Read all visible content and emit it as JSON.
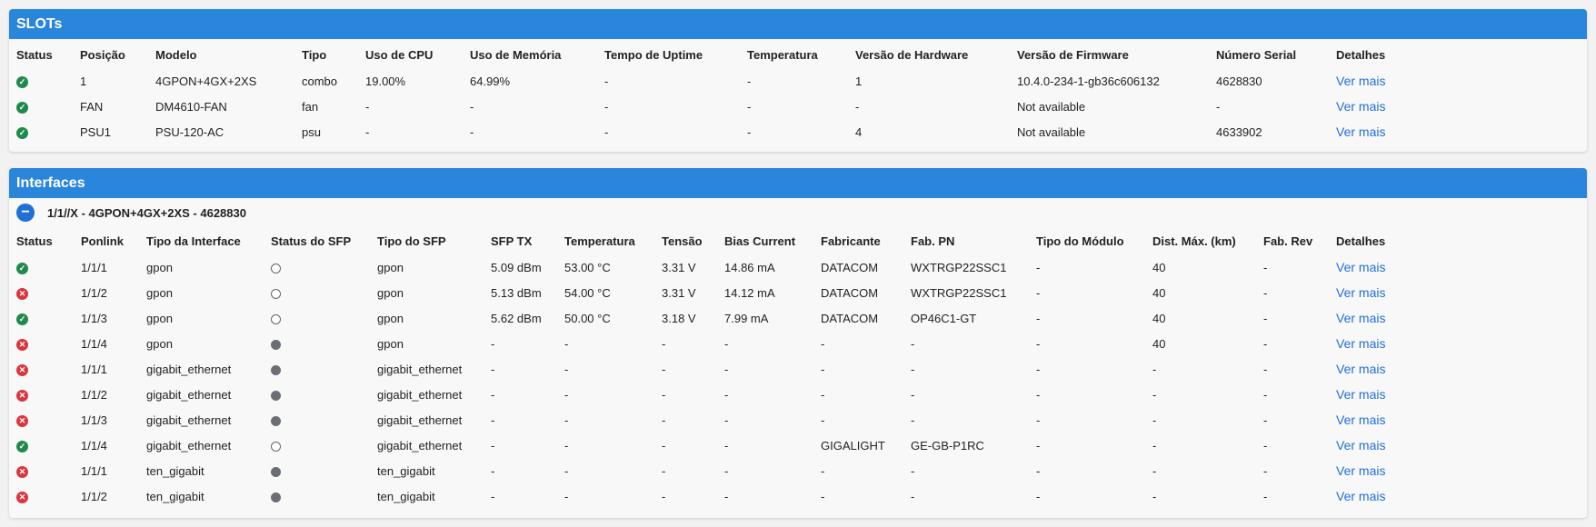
{
  "slots": {
    "title": "SLOTs",
    "columns": [
      "Status",
      "Posição",
      "Modelo",
      "Tipo",
      "Uso de CPU",
      "Uso de Memória",
      "Tempo de Uptime",
      "Temperatura",
      "Versão de Hardware",
      "Versão de Firmware",
      "Número Serial",
      "Detalhes"
    ],
    "rows": [
      {
        "status": "ok",
        "position": "1",
        "model": "4GPON+4GX+2XS",
        "type": "combo",
        "cpu": "19.00%",
        "memory": "64.99%",
        "uptime": "-",
        "temperature": "-",
        "hw": "1",
        "fw": "10.4.0-234-1-gb36c606132",
        "serial": "4628830",
        "details": "Ver mais"
      },
      {
        "status": "ok",
        "position": "FAN",
        "model": "DM4610-FAN",
        "type": "fan",
        "cpu": "-",
        "memory": "-",
        "uptime": "-",
        "temperature": "-",
        "hw": "-",
        "fw": "Not available",
        "serial": "-",
        "details": "Ver mais"
      },
      {
        "status": "ok",
        "position": "PSU1",
        "model": "PSU-120-AC",
        "type": "psu",
        "cpu": "-",
        "memory": "-",
        "uptime": "-",
        "temperature": "-",
        "hw": "4",
        "fw": "Not available",
        "serial": "4633902",
        "details": "Ver mais"
      }
    ]
  },
  "interfaces": {
    "title": "Interfaces",
    "group_title": "1/1//X - 4GPON+4GX+2XS - 4628830",
    "toggle_symbol": "−",
    "columns": [
      "Status",
      "Ponlink",
      "Tipo da Interface",
      "Status do SFP",
      "Tipo do SFP",
      "SFP TX",
      "Temperatura",
      "Tensão",
      "Bias Current",
      "Fabricante",
      "Fab. PN",
      "Tipo do Módulo",
      "Dist. Máx. (km)",
      "Fab. Rev",
      "Detalhes"
    ],
    "rows": [
      {
        "status": "ok",
        "ponlink": "1/1/1",
        "iface_type": "gpon",
        "sfp_status": "empty",
        "sfp_type": "gpon",
        "sfp_tx": "5.09 dBm",
        "temperature": "53.00 °C",
        "voltage": "3.31 V",
        "bias": "14.86 mA",
        "vendor": "DATACOM",
        "pn": "WXTRGP22SSC1",
        "module": "-",
        "dist": "40",
        "rev": "-",
        "details": "Ver mais"
      },
      {
        "status": "err",
        "ponlink": "1/1/2",
        "iface_type": "gpon",
        "sfp_status": "empty",
        "sfp_type": "gpon",
        "sfp_tx": "5.13 dBm",
        "temperature": "54.00 °C",
        "voltage": "3.31 V",
        "bias": "14.12 mA",
        "vendor": "DATACOM",
        "pn": "WXTRGP22SSC1",
        "module": "-",
        "dist": "40",
        "rev": "-",
        "details": "Ver mais"
      },
      {
        "status": "ok",
        "ponlink": "1/1/3",
        "iface_type": "gpon",
        "sfp_status": "empty",
        "sfp_type": "gpon",
        "sfp_tx": "5.62 dBm",
        "temperature": "50.00 °C",
        "voltage": "3.18 V",
        "bias": "7.99 mA",
        "vendor": "DATACOM",
        "pn": "OP46C1-GT",
        "module": "-",
        "dist": "40",
        "rev": "-",
        "details": "Ver mais"
      },
      {
        "status": "err",
        "ponlink": "1/1/4",
        "iface_type": "gpon",
        "sfp_status": "full",
        "sfp_type": "gpon",
        "sfp_tx": "-",
        "temperature": "-",
        "voltage": "-",
        "bias": "-",
        "vendor": "-",
        "pn": "-",
        "module": "-",
        "dist": "40",
        "rev": "-",
        "details": "Ver mais"
      },
      {
        "status": "err",
        "ponlink": "1/1/1",
        "iface_type": "gigabit_ethernet",
        "sfp_status": "full",
        "sfp_type": "gigabit_ethernet",
        "sfp_tx": "-",
        "temperature": "-",
        "voltage": "-",
        "bias": "-",
        "vendor": "-",
        "pn": "-",
        "module": "-",
        "dist": "-",
        "rev": "-",
        "details": "Ver mais"
      },
      {
        "status": "err",
        "ponlink": "1/1/2",
        "iface_type": "gigabit_ethernet",
        "sfp_status": "full",
        "sfp_type": "gigabit_ethernet",
        "sfp_tx": "-",
        "temperature": "-",
        "voltage": "-",
        "bias": "-",
        "vendor": "-",
        "pn": "-",
        "module": "-",
        "dist": "-",
        "rev": "-",
        "details": "Ver mais"
      },
      {
        "status": "err",
        "ponlink": "1/1/3",
        "iface_type": "gigabit_ethernet",
        "sfp_status": "full",
        "sfp_type": "gigabit_ethernet",
        "sfp_tx": "-",
        "temperature": "-",
        "voltage": "-",
        "bias": "-",
        "vendor": "-",
        "pn": "-",
        "module": "-",
        "dist": "-",
        "rev": "-",
        "details": "Ver mais"
      },
      {
        "status": "ok",
        "ponlink": "1/1/4",
        "iface_type": "gigabit_ethernet",
        "sfp_status": "empty",
        "sfp_type": "gigabit_ethernet",
        "sfp_tx": "-",
        "temperature": "-",
        "voltage": "-",
        "bias": "-",
        "vendor": "GIGALIGHT",
        "pn": "GE-GB-P1RC",
        "module": "-",
        "dist": "-",
        "rev": "-",
        "details": "Ver mais"
      },
      {
        "status": "err",
        "ponlink": "1/1/1",
        "iface_type": "ten_gigabit",
        "sfp_status": "full",
        "sfp_type": "ten_gigabit",
        "sfp_tx": "-",
        "temperature": "-",
        "voltage": "-",
        "bias": "-",
        "vendor": "-",
        "pn": "-",
        "module": "-",
        "dist": "-",
        "rev": "-",
        "details": "Ver mais"
      },
      {
        "status": "err",
        "ponlink": "1/1/2",
        "iface_type": "ten_gigabit",
        "sfp_status": "full",
        "sfp_type": "ten_gigabit",
        "sfp_tx": "-",
        "temperature": "-",
        "voltage": "-",
        "bias": "-",
        "vendor": "-",
        "pn": "-",
        "module": "-",
        "dist": "-",
        "rev": "-",
        "details": "Ver mais"
      }
    ]
  },
  "icons": {
    "ok": "check-circle-icon",
    "err": "x-circle-icon",
    "sfp_empty": "empty-circle-icon",
    "sfp_full": "filled-circle-icon"
  },
  "colors": {
    "header": "#2a86db",
    "ok": "#1f8a4c",
    "err": "#d9363e",
    "link": "#1f6fd6",
    "sfp_full": "#6b6f75"
  }
}
